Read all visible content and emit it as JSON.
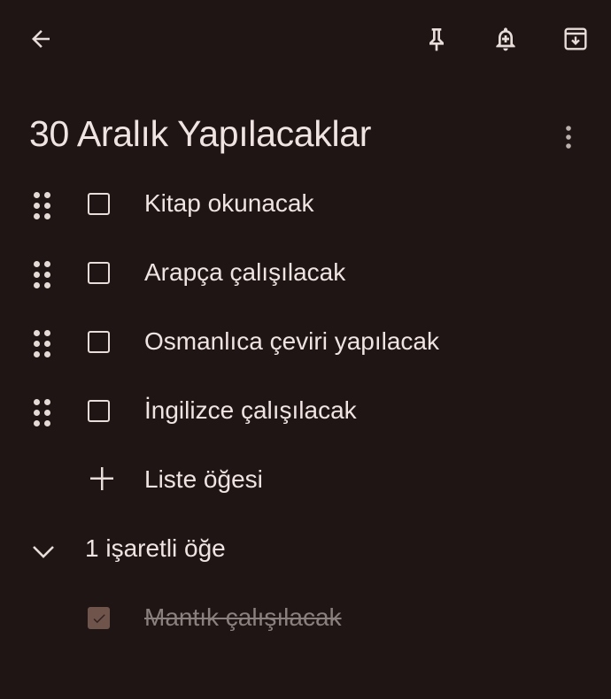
{
  "header": {
    "back_icon": "arrow-left-icon",
    "pin_icon": "pin-icon",
    "reminder_icon": "bell-plus-icon",
    "archive_icon": "archive-icon"
  },
  "note": {
    "title": "30 Aralık Yapılacaklar",
    "menu_icon": "more-vertical-icon",
    "items": [
      {
        "label": "Kitap okunacak",
        "checked": false
      },
      {
        "label": "Arapça çalışılacak",
        "checked": false
      },
      {
        "label": "Osmanlıca çeviri yapılacak",
        "checked": false
      },
      {
        "label": "İngilizce çalışılacak",
        "checked": false
      }
    ],
    "add_item_label": "Liste öğesi",
    "checked_section_label": "1 işaretli öğe",
    "checked_items": [
      {
        "label": "Mantık çalışılacak",
        "checked": true
      }
    ]
  },
  "colors": {
    "background": "#1e1514",
    "text": "#efe4e1",
    "checked_box": "#8a6a5f",
    "checked_text": "#8a807d"
  }
}
